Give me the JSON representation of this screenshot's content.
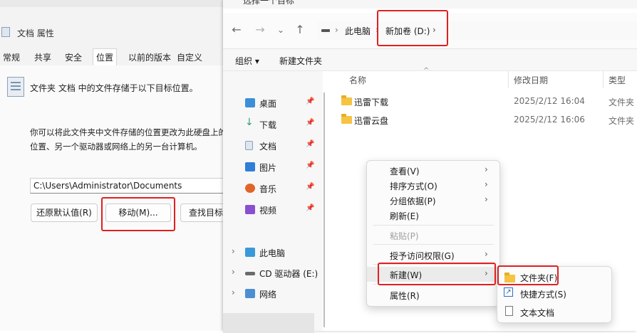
{
  "properties": {
    "title": "文档 属性",
    "tabs": [
      "常规",
      "共享",
      "安全",
      "位置",
      "以前的版本",
      "自定义"
    ],
    "active_tab": "位置",
    "description_1": "文件夹 文档 中的文件存储于以下目标位置。",
    "description_2a": "你可以将此文件夹中文件存储的位置更改为此硬盘上的另",
    "description_2b": "位置、另一个驱动器或网络上的另一台计算机。",
    "path_value": "C:\\Users\\Administrator\\Documents",
    "buttons": {
      "restore": "还原默认值(R)",
      "move": "移动(M)...",
      "find": "查找目标"
    }
  },
  "explorer": {
    "title": "选择一个目标",
    "breadcrumb": {
      "root": "此电脑",
      "current": "新加卷 (D:)"
    },
    "commands": {
      "organize": "组织 ▾",
      "new_folder": "新建文件夹"
    },
    "columns": {
      "name": "名称",
      "date": "修改日期",
      "type": "类型"
    },
    "files": [
      {
        "name": "迅雷下载",
        "date": "2025/2/12 16:04",
        "type": "文件夹"
      },
      {
        "name": "迅雷云盘",
        "date": "2025/2/12 16:06",
        "type": "文件夹"
      }
    ],
    "sidebar_quick": [
      {
        "label": "桌面",
        "icon": "desktop-icon",
        "color": "#3a8fd8"
      },
      {
        "label": "下载",
        "icon": "download-icon",
        "color": "#2e9e6a"
      },
      {
        "label": "文档",
        "icon": "document-icon",
        "color": "#8aa1b8"
      },
      {
        "label": "图片",
        "icon": "pictures-icon",
        "color": "#2f7ed8"
      },
      {
        "label": "音乐",
        "icon": "music-icon",
        "color": "#e0652b"
      },
      {
        "label": "视频",
        "icon": "video-icon",
        "color": "#8a4fd1"
      }
    ],
    "sidebar_tree": [
      {
        "label": "此电脑",
        "icon": "pc-icon"
      },
      {
        "label": "CD 驱动器 (E:)",
        "icon": "cd-drive-icon"
      },
      {
        "label": "网络",
        "icon": "network-icon"
      }
    ]
  },
  "context_menu": {
    "items": [
      {
        "label": "查看(V)",
        "arrow": true
      },
      {
        "label": "排序方式(O)",
        "arrow": true
      },
      {
        "label": "分组依据(P)",
        "arrow": true
      },
      {
        "label": "刷新(E)",
        "arrow": false
      },
      {
        "label": "粘贴(P)",
        "arrow": false,
        "disabled": true
      },
      {
        "label": "授予访问权限(G)",
        "arrow": true
      },
      {
        "label": "新建(W)",
        "arrow": true
      },
      {
        "label": "属性(R)",
        "arrow": false
      }
    ],
    "submenu": [
      {
        "label": "文件夹(F)",
        "icon": "folder-icon"
      },
      {
        "label": "快捷方式(S)",
        "icon": "shortcut-icon"
      },
      {
        "label": "文本文档",
        "icon": "text-document-icon"
      }
    ]
  },
  "colors": {
    "highlight_red": "#e02020",
    "folder_yellow": "#f6c343"
  }
}
